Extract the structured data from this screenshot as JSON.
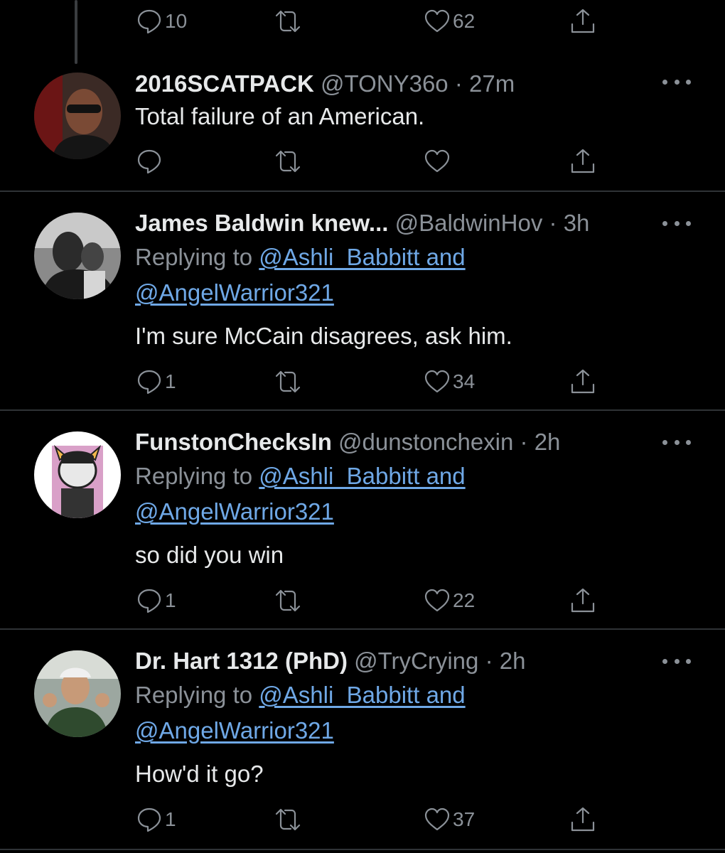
{
  "top_actions": {
    "replies": "10",
    "retweets": "",
    "likes": "62"
  },
  "tweets": [
    {
      "name": "2016SCATPACK",
      "handle": "@TONY36o",
      "sep": "·",
      "time": "27m",
      "replying_prefix": "",
      "replying_line1": "",
      "replying_line2": "",
      "text": "Total failure of an American.",
      "replies": "",
      "retweets": "",
      "likes": ""
    },
    {
      "name": "James Baldwin knew...",
      "handle": "@BaldwinHov",
      "sep": "·",
      "time": "3h",
      "replying_prefix": "Replying to",
      "replying_line1": "@Ashli_Babbitt and",
      "replying_line2": "@AngelWarrior321",
      "text": "I'm sure McCain disagrees, ask him.",
      "replies": "1",
      "retweets": "",
      "likes": "34"
    },
    {
      "name": "FunstonChecksIn",
      "handle": "@dunstonchexin",
      "sep": "·",
      "time": "2h",
      "replying_prefix": "Replying to",
      "replying_line1": "@Ashli_Babbitt and",
      "replying_line2": "@AngelWarrior321",
      "text": "so did you win",
      "replies": "1",
      "retweets": "",
      "likes": "22"
    },
    {
      "name": "Dr. Hart 1312 (PhD)",
      "handle": "@TryCrying",
      "sep": "·",
      "time": "2h",
      "replying_prefix": "Replying to",
      "replying_line1": "@Ashli_Babbitt and",
      "replying_line2": "@AngelWarrior321",
      "text": "How'd it go?",
      "replies": "1",
      "retweets": "",
      "likes": "37"
    }
  ],
  "icons": [
    "reply-icon",
    "retweet-icon",
    "like-icon",
    "share-icon",
    "more-icon"
  ],
  "colors": {
    "background": "#000000",
    "text": "#e7e9ea",
    "muted": "#8b9198",
    "link": "#6fa8e6",
    "divider": "#2f3336"
  }
}
